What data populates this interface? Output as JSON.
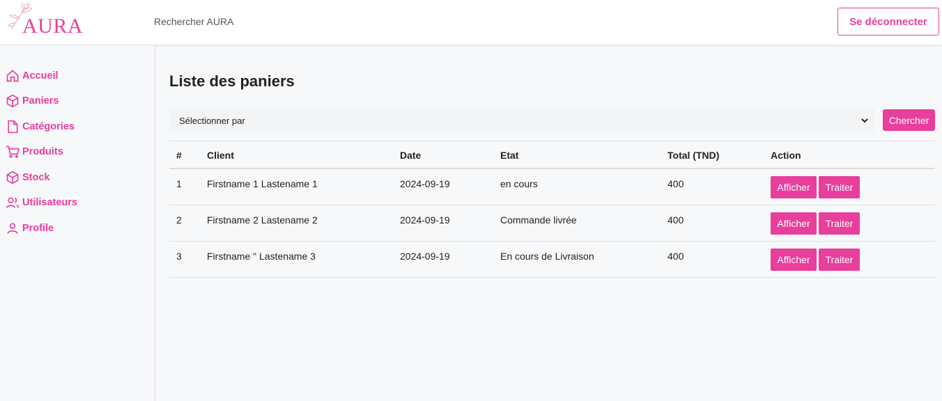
{
  "header": {
    "logo_text": "AURA",
    "search_text": "Rechercher AURA",
    "logout_label": "Se déconnecter"
  },
  "sidebar": {
    "items": [
      {
        "label": "Accueil",
        "icon": "home-icon"
      },
      {
        "label": "Paniers",
        "icon": "box-icon"
      },
      {
        "label": "Catégories",
        "icon": "file-icon"
      },
      {
        "label": "Produits",
        "icon": "cart-icon"
      },
      {
        "label": "Stock",
        "icon": "box-icon"
      },
      {
        "label": "Utilisateurs",
        "icon": "users-icon"
      },
      {
        "label": "Profile",
        "icon": "user-icon"
      }
    ]
  },
  "main": {
    "title": "Liste des paniers",
    "filter_placeholder": "Sélectionner par",
    "search_button": "Chercher",
    "columns": [
      "#",
      "Client",
      "Date",
      "Etat",
      "Total (TND)",
      "Action"
    ],
    "rows": [
      {
        "num": "1",
        "client": "Firstname 1 Lastename 1",
        "date": "2024-09-19",
        "etat": "en cours",
        "total": "400"
      },
      {
        "num": "2",
        "client": "Firstname 2 Lastename 2",
        "date": "2024-09-19",
        "etat": "Commande livrée",
        "total": "400"
      },
      {
        "num": "3",
        "client": "Firstname \" Lastename 3",
        "date": "2024-09-19",
        "etat": "En cours de Livraison",
        "total": "400"
      }
    ],
    "action_view": "Afficher",
    "action_process": "Traiter"
  },
  "colors": {
    "accent": "#e83e9c",
    "background": "#f7f8fa"
  }
}
